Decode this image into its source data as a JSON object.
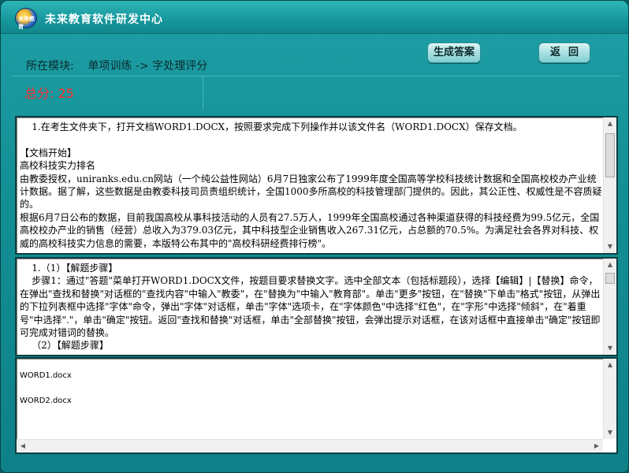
{
  "app": {
    "title": "未来教育软件研发中心",
    "logo_text": "未来教育"
  },
  "module": {
    "label": "所在模块:",
    "path": "单项训练 -> 字处理评分"
  },
  "toolbar": {
    "generate_label": "生成答案",
    "back_label": "返回"
  },
  "score": {
    "text": "总分: 25"
  },
  "panels": {
    "question": "    1.在考生文件夹下，打开文档WORD1.DOCX，按照要求完成下列操作并以该文件名（WORD1.DOCX）保存文档。\n\n【文档开始】\n高校科技实力排名\n由教委授权，uniranks.edu.cn网站（一个纯公益性网站）6月7日独家公布了1999年度全国高等学校科技统计数据和全国高校校办产业统计数据。据了解，这些数据是由教委科技司员责组织统计，全国1000多所高校的科技管理部门提供的。因此，其公正性、权威性是不容质疑的。\n根据6月7日公布的数据，目前我国高校从事科技活动的人员有27.5万人，1999年全国高校通过各种渠道获得的科技经费为99.5亿元，全国高校校办产业的销售（经营）总收入为379.03亿元，其中科技型企业销售收入267.31亿元，占总额的70.5%。为满足社会各界对科技、权威的高校科技实力信息的需要，本版特公布其中的\"高校科研经费排行榜\"。",
    "steps": "    1.（1）【解题步骤】\n    步骤1：通过\"答题\"菜单打开WORD1.DOCX文件，按题目要求替换文字。选中全部文本（包括标题段），选择【编辑】|【替换】命令，在弹出\"查找和替换\"对话框的\"查找内容\"中输入\"教委\"，在\"替换为\"中输入\"教育部\"。单击\"更多\"按钮，在\"替换\"下单击\"格式\"按钮，从弹出的下拉列表框中选择\"字体\"命令，弹出\"字体\"对话框，单击\"字体\"选项卡，在\"字体颜色\"中选择\"红色\"，在\"字形\"中选择\"倾斜\"，在\"着重号\"中选择\".\"，单击\"确定\"按钮。返回\"查找和替换\"对话框，单击\"全部替换\"按钮，会弹出提示对话框，在该对话框中直接单击\"确定\"按钮即可完成对错词的替换。\n    （2）【解题步骤】",
    "files": [
      "WORD1.docx",
      "WORD2.docx"
    ]
  },
  "scrollbars": {
    "up_arrow": "▲",
    "down_arrow": "▼",
    "left_arrow": "◀",
    "right_arrow": "▶"
  },
  "colors": {
    "window_bg": "#138f95",
    "score_color": "#ff2a2a",
    "button_bg": "#a9e0e2"
  }
}
